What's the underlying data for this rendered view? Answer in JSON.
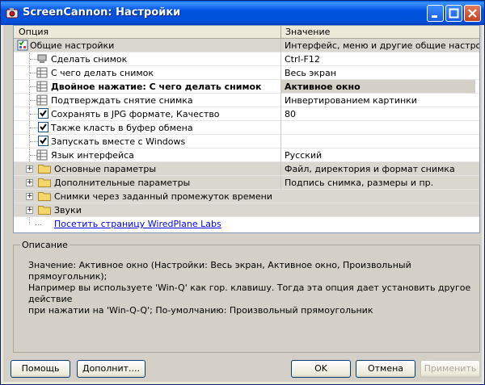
{
  "window": {
    "title": "ScreenCannon: Настройки"
  },
  "grid": {
    "col_option": "Опция",
    "col_value": "Значение",
    "rows": [
      {
        "label": "Общие настройки",
        "value": "Интерфейс, меню и другие общие настройки"
      },
      {
        "label": "Сделать снимок",
        "value": "Ctrl-F12"
      },
      {
        "label": "С чего делать снимок",
        "value": "Весь экран"
      },
      {
        "label": "Двойное нажатие: С чего делать снимок",
        "value": "Активное окно"
      },
      {
        "label": "Подтверждать снятие снимка",
        "value": "Инвертированием картинки"
      },
      {
        "label": "Сохранять в JPG формате, Качество",
        "value": "80",
        "checked": true
      },
      {
        "label": "Также класть в буфер обмена",
        "checked": true
      },
      {
        "label": "Запускать вместе с Windows",
        "checked": true
      },
      {
        "label": "Язык интерфейса",
        "value": "Русский"
      },
      {
        "label": "Основные параметры",
        "value": "Файл, директория и формат снимка"
      },
      {
        "label": "Дополнительные параметры",
        "value": "Подпись снимка, размеры и пр."
      },
      {
        "label": "Снимки через заданный промежуток времени"
      },
      {
        "label": "Звуки"
      },
      {
        "label": "Посетить страницу WiredPlane Labs"
      }
    ]
  },
  "description": {
    "title": "Описание",
    "text": "Значение: Активное окно (Настройки: Весь экран, Активное окно, Произвольный прямоугольник);\nНапример вы используете 'Win-Q' как гор. клавишу. Тогда эта опция дает установить другое действие\nпри нажатии на 'Win-Q-Q'; По-умолчанию: Произвольный прямоугольник"
  },
  "buttons": {
    "help": "Помощь",
    "more": "Дополнит....",
    "ok": "OK",
    "cancel": "Отмена",
    "apply": "Применить"
  },
  "icons": {
    "app": "camera-icon",
    "settings": "checklist-icon",
    "option": "option-grid-icon",
    "folder": "folder-icon"
  }
}
